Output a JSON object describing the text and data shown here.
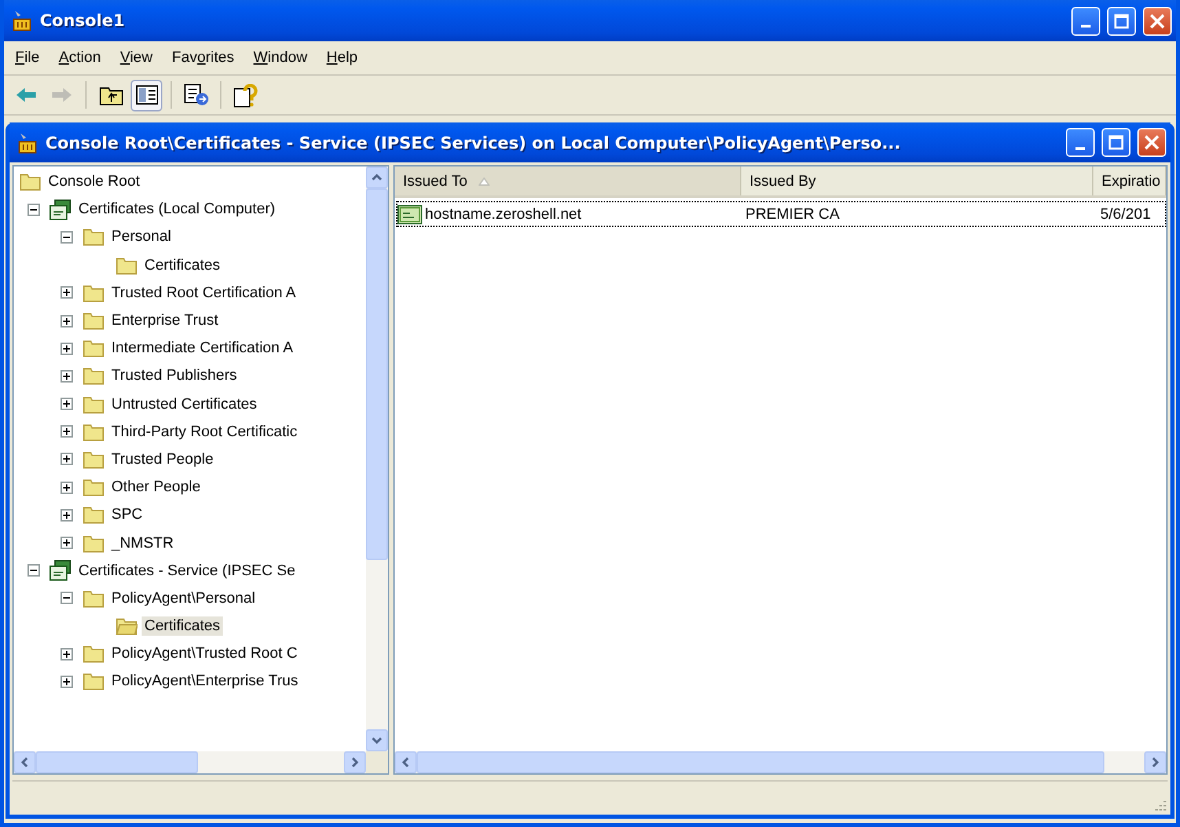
{
  "window": {
    "title": "Console1"
  },
  "menu": [
    {
      "key": "F",
      "after": "ile"
    },
    {
      "key": "A",
      "after": "ction"
    },
    {
      "key": "V",
      "after": "iew"
    },
    {
      "before": "Fav",
      "key": "o",
      "after": "rites"
    },
    {
      "key": "W",
      "after": "indow"
    },
    {
      "key": "H",
      "after": "elp"
    }
  ],
  "toolbar": [
    {
      "kind": "back",
      "disabled": false,
      "pressed": false
    },
    {
      "kind": "forward",
      "disabled": true,
      "pressed": false
    },
    {
      "kind": "separator"
    },
    {
      "kind": "up",
      "disabled": false,
      "pressed": false
    },
    {
      "kind": "tree",
      "disabled": false,
      "pressed": true
    },
    {
      "kind": "separator"
    },
    {
      "kind": "export",
      "disabled": false,
      "pressed": false
    },
    {
      "kind": "separator"
    },
    {
      "kind": "help",
      "disabled": false,
      "pressed": false
    }
  ],
  "child_window": {
    "title": "Console Root\\Certificates - Service (IPSEC Services) on Local Computer\\PolicyAgent\\Perso..."
  },
  "tree": {
    "root": "Console Root",
    "items": [
      {
        "label": "Certificates (Local Computer)",
        "kind": "store",
        "expanded": true,
        "selected": false,
        "children": [
          {
            "label": "Personal",
            "kind": "folder",
            "expanded": true,
            "selected": false,
            "children": [
              {
                "label": "Certificates",
                "kind": "folder",
                "selected": false
              }
            ]
          },
          {
            "label": "Trusted Root Certification A",
            "kind": "folder",
            "expanded": false,
            "selected": false
          },
          {
            "label": "Enterprise Trust",
            "kind": "folder",
            "expanded": false,
            "selected": false
          },
          {
            "label": "Intermediate Certification A",
            "kind": "folder",
            "expanded": false,
            "selected": false
          },
          {
            "label": "Trusted Publishers",
            "kind": "folder",
            "expanded": false,
            "selected": false
          },
          {
            "label": "Untrusted Certificates",
            "kind": "folder",
            "expanded": false,
            "selected": false
          },
          {
            "label": "Third-Party Root Certificatic",
            "kind": "folder",
            "expanded": false,
            "selected": false
          },
          {
            "label": "Trusted People",
            "kind": "folder",
            "expanded": false,
            "selected": false
          },
          {
            "label": "Other People",
            "kind": "folder",
            "expanded": false,
            "selected": false
          },
          {
            "label": "SPC",
            "kind": "folder",
            "expanded": false,
            "selected": false
          },
          {
            "label": "_NMSTR",
            "kind": "folder",
            "expanded": false,
            "selected": false
          }
        ]
      },
      {
        "label": "Certificates - Service (IPSEC Se",
        "kind": "store",
        "expanded": true,
        "selected": false,
        "children": [
          {
            "label": "PolicyAgent\\Personal",
            "kind": "folder",
            "expanded": true,
            "selected": false,
            "children": [
              {
                "label": "Certificates",
                "kind": "folder",
                "selected": true
              }
            ]
          },
          {
            "label": "PolicyAgent\\Trusted Root C",
            "kind": "folder",
            "expanded": false,
            "selected": false
          },
          {
            "label": "PolicyAgent\\Enterprise Trus",
            "kind": "folder",
            "expanded": false,
            "selected": false
          }
        ]
      }
    ]
  },
  "list": {
    "columns": [
      {
        "label": "Issued To",
        "sorted": true
      },
      {
        "label": "Issued By",
        "sorted": false
      },
      {
        "label": "Expiratio",
        "sorted": false
      }
    ],
    "rows": [
      {
        "cells": [
          "hostname.zeroshell.net",
          "PREMIER CA",
          "5/6/201"
        ],
        "focused": true
      }
    ]
  }
}
